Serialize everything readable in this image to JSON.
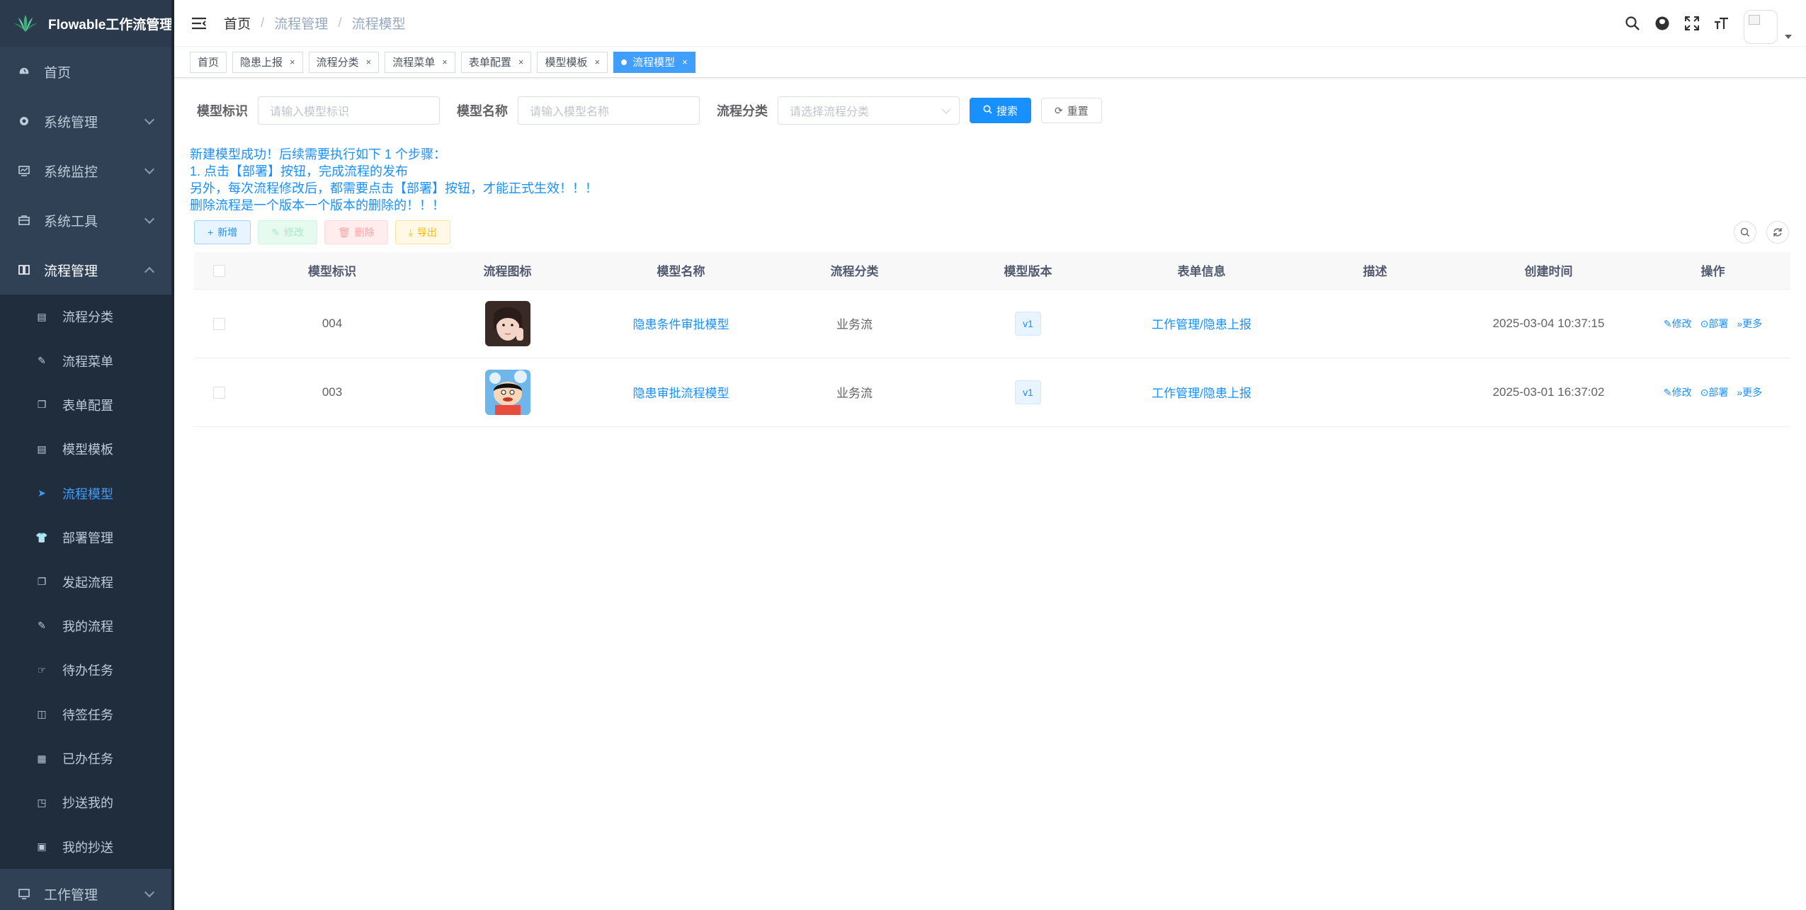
{
  "app": {
    "title": "Flowable工作流管理"
  },
  "sidebar": {
    "items": [
      {
        "label": "首页",
        "icon": "dashboard-icon"
      },
      {
        "label": "系统管理",
        "icon": "gear-icon"
      },
      {
        "label": "系统监控",
        "icon": "monitor-icon"
      },
      {
        "label": "系统工具",
        "icon": "toolbox-icon"
      },
      {
        "label": "流程管理",
        "icon": "book-icon"
      }
    ],
    "flow_sub": [
      {
        "label": "流程分类"
      },
      {
        "label": "流程菜单"
      },
      {
        "label": "表单配置"
      },
      {
        "label": "模型模板"
      },
      {
        "label": "流程模型"
      },
      {
        "label": "部署管理"
      },
      {
        "label": "发起流程"
      },
      {
        "label": "我的流程"
      },
      {
        "label": "待办任务"
      },
      {
        "label": "待签任务"
      },
      {
        "label": "已办任务"
      },
      {
        "label": "抄送我的"
      },
      {
        "label": "我的抄送"
      }
    ],
    "bottom_item": {
      "label": "工作管理"
    }
  },
  "breadcrumb": [
    "首页",
    "流程管理",
    "流程模型"
  ],
  "tags": [
    "首页",
    "隐患上报",
    "流程分类",
    "流程菜单",
    "表单配置",
    "模型模板",
    "流程模型"
  ],
  "search": {
    "model_key_label": "模型标识",
    "model_key_placeholder": "请输入模型标识",
    "model_name_label": "模型名称",
    "model_name_placeholder": "请输入模型名称",
    "category_label": "流程分类",
    "category_placeholder": "请选择流程分类",
    "search_btn": "搜索",
    "reset_btn": "重置"
  },
  "notice": [
    "新建模型成功！后续需要执行如下 1 个步骤：",
    "1. 点击【部署】按钮，完成流程的发布",
    "另外，每次流程修改后，都需要点击【部署】按钮，才能正式生效！！！",
    "删除流程是一个版本一个版本的删除的！！！"
  ],
  "toolbar": {
    "add": "新增",
    "edit": "修改",
    "delete": "删除",
    "export": "导出"
  },
  "table": {
    "columns": [
      "模型标识",
      "流程图标",
      "模型名称",
      "流程分类",
      "模型版本",
      "表单信息",
      "描述",
      "创建时间",
      "操作"
    ],
    "rows": [
      {
        "key": "004",
        "name": "隐患条件审批模型",
        "category": "业务流",
        "version": "v1",
        "form": "工作管理/隐患上报",
        "desc": "",
        "created": "2025-03-04 10:37:15"
      },
      {
        "key": "003",
        "name": "隐患审批流程模型",
        "category": "业务流",
        "version": "v1",
        "form": "工作管理/隐患上报",
        "desc": "",
        "created": "2025-03-01 16:37:02"
      }
    ],
    "ops": {
      "edit": "修改",
      "deploy": "部署",
      "more": "更多"
    }
  },
  "colors": {
    "sidebar_bg": "#304156",
    "primary": "#1890ff",
    "active_menu": "#409eff"
  }
}
